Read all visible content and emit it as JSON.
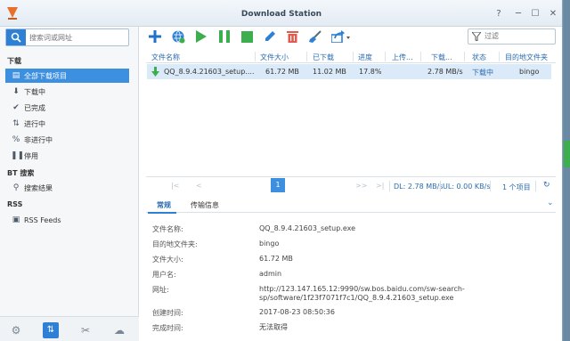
{
  "window": {
    "title": "Download Station"
  },
  "sidebar": {
    "search_placeholder": "搜索词或网址",
    "sections": {
      "download": "下载",
      "bt": "BT 搜索",
      "rss": "RSS"
    },
    "items": [
      {
        "label": "全部下载项目",
        "icon": "list-icon"
      },
      {
        "label": "下载中",
        "icon": "arrow-down-icon"
      },
      {
        "label": "已完成",
        "icon": "check-icon"
      },
      {
        "label": "进行中",
        "icon": "transfer-icon"
      },
      {
        "label": "非进行中",
        "icon": "percent-icon"
      },
      {
        "label": "停用",
        "icon": "pause-icon"
      },
      {
        "label": "搜索结果",
        "icon": "search-icon"
      },
      {
        "label": "RSS Feeds",
        "icon": "rss-icon"
      }
    ]
  },
  "toolbar": {
    "filter_placeholder": "过滤"
  },
  "grid": {
    "columns": [
      "文件名称",
      "文件大小",
      "已下载",
      "进度",
      "上传...",
      "下载...",
      "状态",
      "目的地文件夹"
    ],
    "rows": [
      {
        "name": "QQ_8.9.4.21603_setup....",
        "size": "61.72 MB",
        "downloaded": "11.02 MB",
        "progress": "17.8%",
        "upload": "",
        "download": "2.78 MB/s",
        "status": "下载中",
        "dest": "bingo"
      }
    ]
  },
  "pager": {
    "current": "1",
    "dl": "DL: 2.78 MB/s",
    "ul": "UL: 0.00 KB/s",
    "count": "1 个项目"
  },
  "details": {
    "tabs": [
      "常规",
      "传输信息"
    ],
    "fields": [
      {
        "label": "文件名称:",
        "value": "QQ_8.9.4.21603_setup.exe"
      },
      {
        "label": "目的地文件夹:",
        "value": "bingo"
      },
      {
        "label": "文件大小:",
        "value": "61.72 MB"
      },
      {
        "label": "用户名:",
        "value": "admin"
      },
      {
        "label": "网址:",
        "value": "http://123.147.165.12:9990/sw.bos.baidu.com/sw-search-",
        "value2": "sp/software/1f23f7071f7c1/QQ_8.9.4.21603_setup.exe"
      },
      {
        "label": "创建时间:",
        "value": "2017-08-23 08:50:36"
      },
      {
        "label": "完成时间:",
        "value": "无法取得"
      }
    ]
  },
  "colors": {
    "accent": "#2e7fd6",
    "active_row": "#dbeaf8",
    "status_text": "#2b6cb0"
  }
}
